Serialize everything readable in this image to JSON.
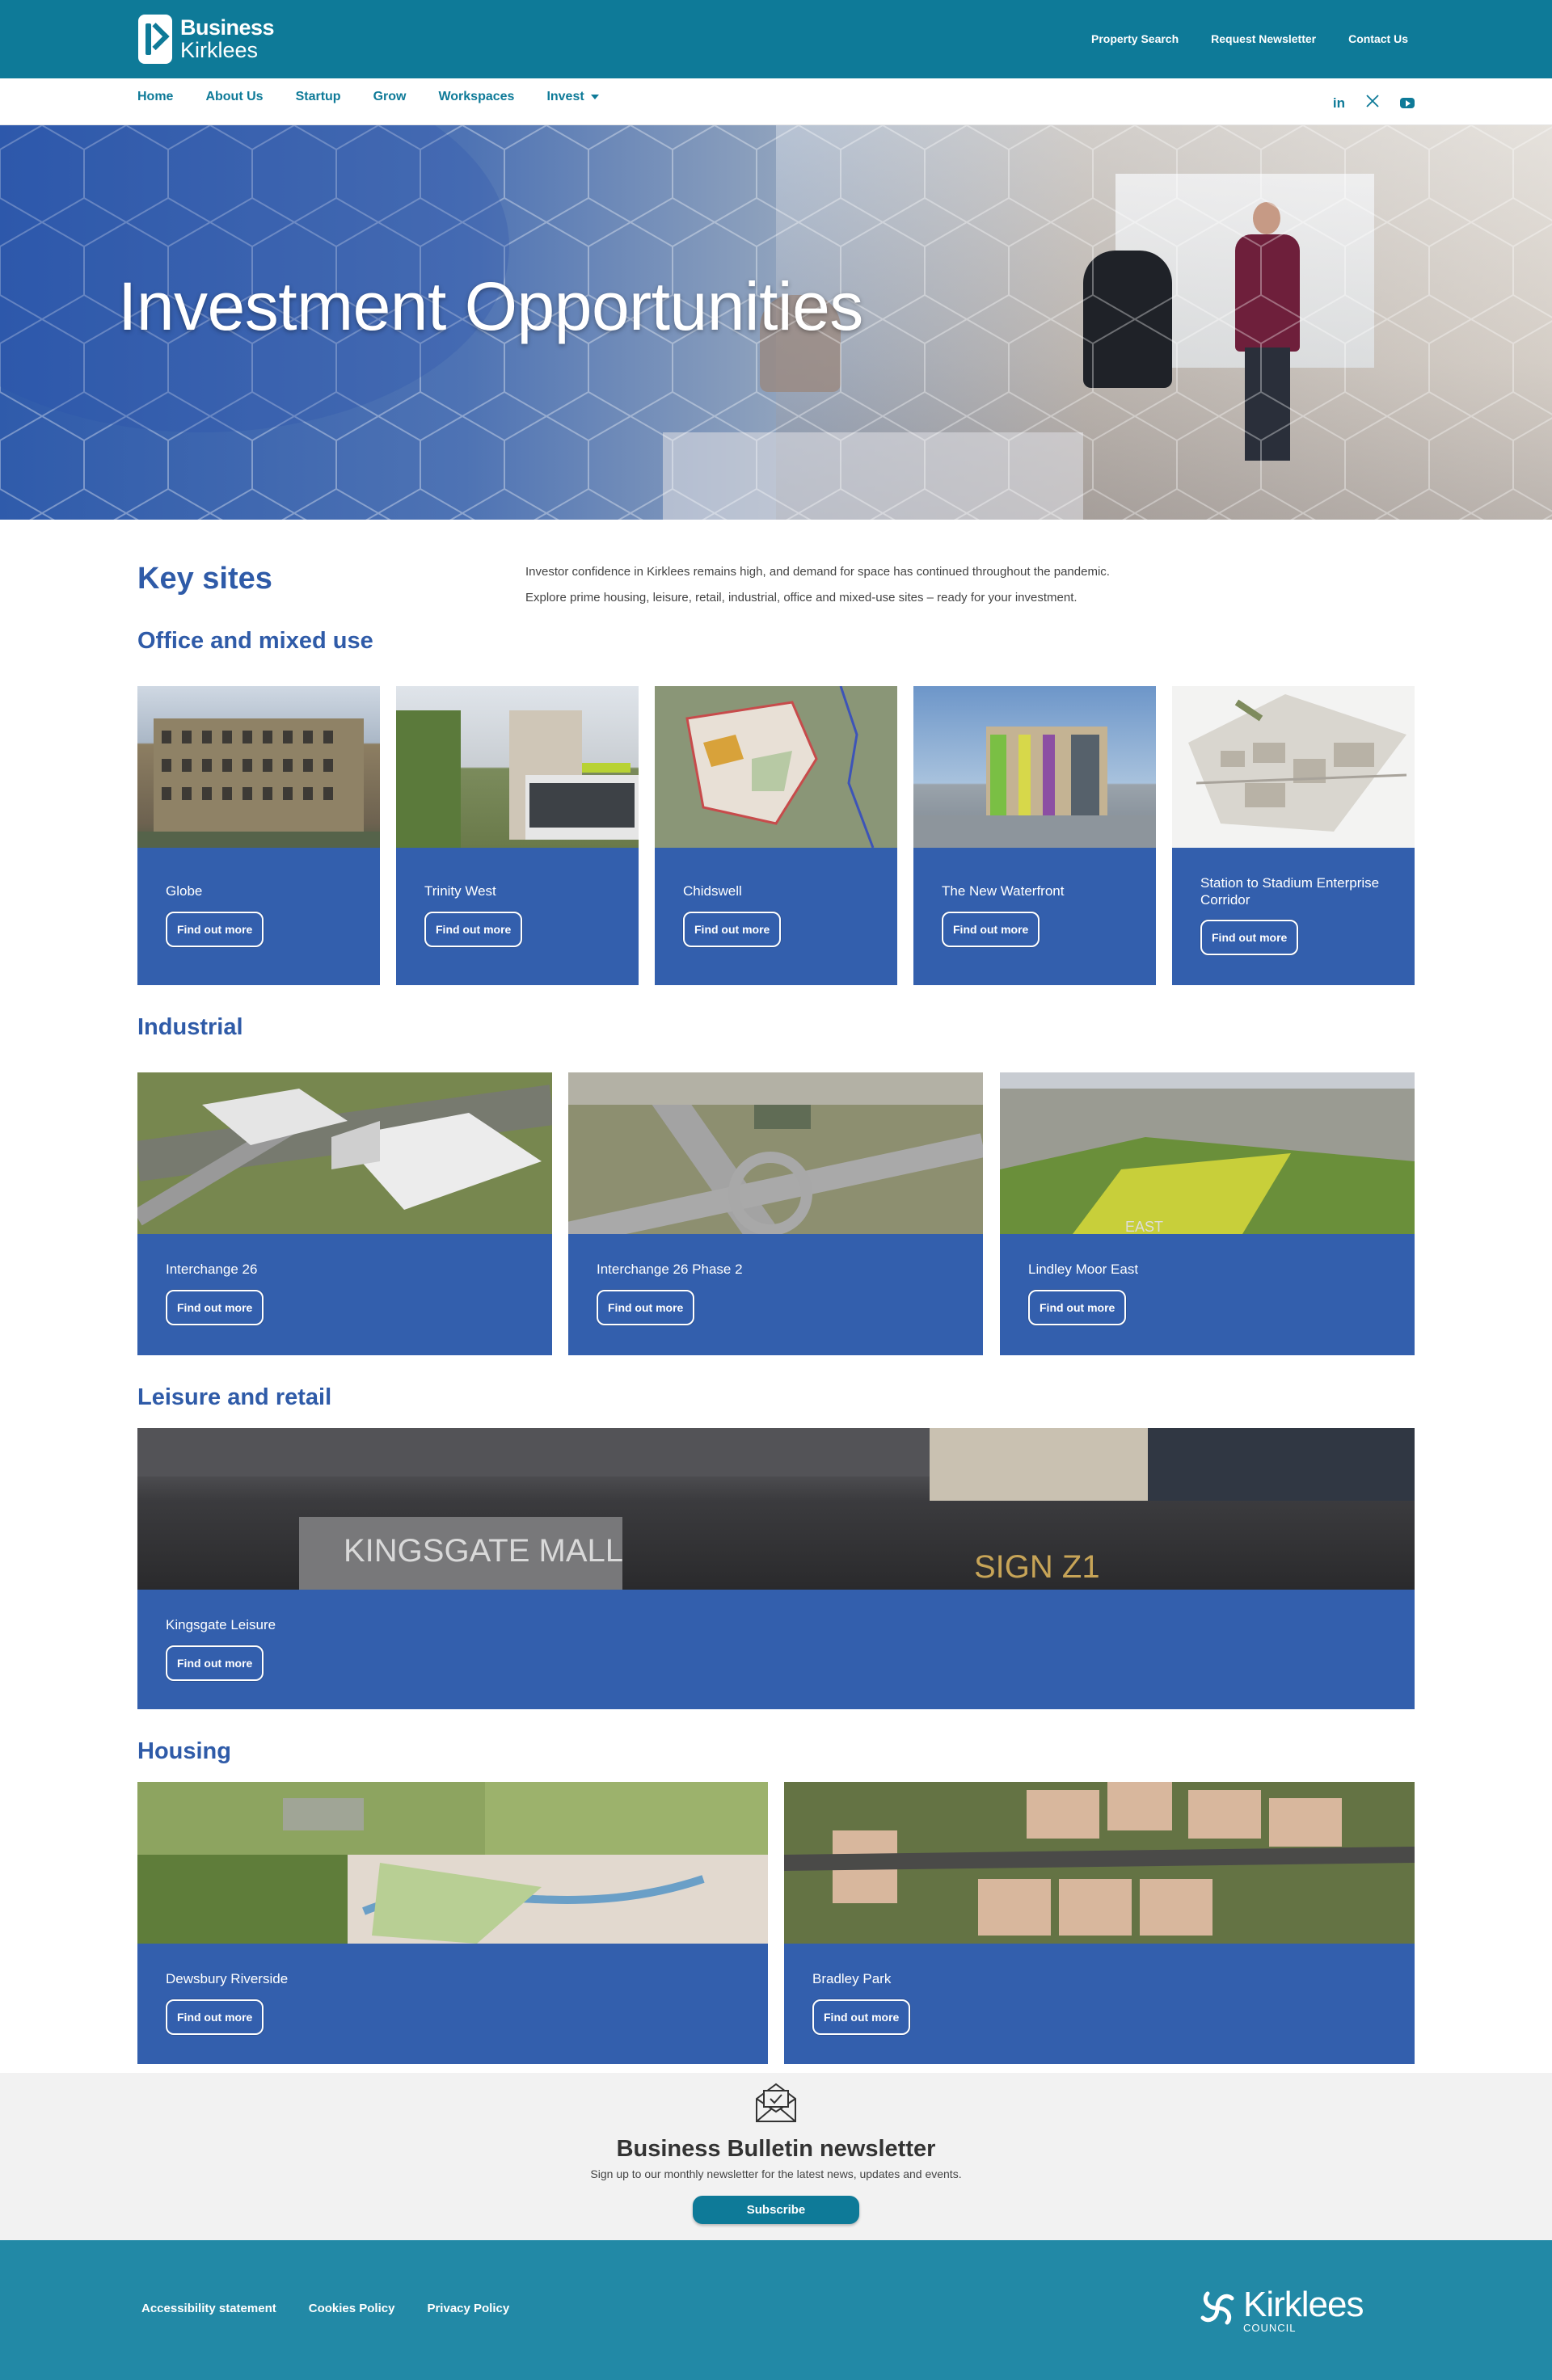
{
  "header": {
    "logo_line1": "Business",
    "logo_line2": "Kirklees",
    "top_links": [
      "Property Search",
      "Request Newsletter",
      "Contact Us"
    ],
    "brand_color": "#0e7a98"
  },
  "nav": {
    "items": [
      "Home",
      "About Us",
      "Startup",
      "Grow",
      "Workspaces",
      "Invest"
    ],
    "social_icons": [
      "linkedin-icon",
      "x-icon",
      "youtube-icon"
    ]
  },
  "hero": {
    "title": "Investment Opportunities"
  },
  "intro": {
    "heading": "Key sites",
    "line1": "Investor confidence in Kirklees remains high, and demand for space has continued throughout the pandemic.",
    "line2": "Explore prime housing, leisure, retail, industrial, office and mixed-use sites – ready for your investment."
  },
  "button_label": "Find out more",
  "sections": {
    "office": {
      "title": "Office and mixed use",
      "cards": [
        "Globe",
        "Trinity West",
        "Chidswell",
        "The New Waterfront",
        "Station to Stadium Enterprise Corridor"
      ]
    },
    "industrial": {
      "title": "Industrial",
      "cards": [
        "Interchange 26",
        "Interchange 26 Phase 2",
        "Lindley Moor East"
      ]
    },
    "leisure": {
      "title": "Leisure and retail",
      "cards": [
        "Kingsgate Leisure"
      ],
      "sign_text_1": "KINGSGATE MALL",
      "sign_text_2": "SIGN Z1"
    },
    "housing": {
      "title": "Housing",
      "cards": [
        "Dewsbury Riverside",
        "Bradley Park"
      ]
    },
    "field_label": "EAST"
  },
  "newsletter": {
    "title": "Business Bulletin newsletter",
    "text": "Sign up to our monthly newsletter for the latest news, updates and events.",
    "button": "Subscribe"
  },
  "footer": {
    "links": [
      "Accessibility statement",
      "Cookies Policy",
      "Privacy Policy"
    ],
    "council_name": "Kirklees",
    "council_sub": "COUNCIL"
  },
  "colors": {
    "card_blue": "#335fad",
    "heading_blue": "#2f5ba8",
    "footer": "#2289a6",
    "newsletter_bg": "#f2f2f2"
  }
}
